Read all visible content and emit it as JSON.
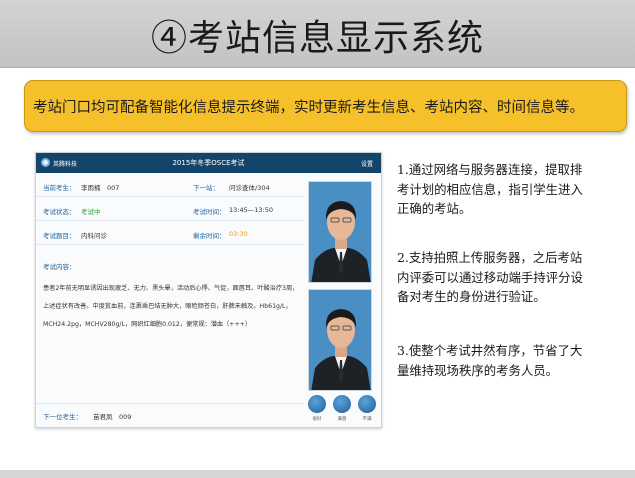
{
  "slide": {
    "title": "④考站信息显示系统",
    "banner": "考站门口均可配备智能化信息提示终端，实时更新考生信息、考站内容、时间信息等。"
  },
  "terminal": {
    "logo_text": "英腾科技",
    "title": "2015年冬季OSCE考试",
    "settings": "设置",
    "current_examinee_label": "当前考生：",
    "current_examinee_value": "李雨楠　007",
    "next_station_label": "下一站：",
    "next_station_value": "问诊查体/304",
    "exam_status_label": "考试状态：",
    "exam_status_value": "考试中",
    "exam_time_label": "考试时间：",
    "exam_time_value": "13:45—13:50",
    "exam_subject_label": "考试题目：",
    "exam_subject_value": "内科问诊",
    "remaining_label": "剩余时间：",
    "remaining_value": "03:30",
    "content_label": "考试内容：",
    "content_lines": [
      "患者2年前无明显诱因出现疲乏、无力、黑头晕，活动后心悸、气促，面唇耳、叶酸治疗3周，",
      "上述症状有改善。中度贫血前，连裹乘巴结无肿大，眼睑颜苍白，肝脾未触及。Hb61g/L，",
      "MCH24.2pg，MCHV280g/L，网织红细胞0.012，便常规：潜血（+++）"
    ],
    "next_examinee_label": "下一位考生：",
    "next_examinee_value": "苗君凤　009",
    "face_labels": [
      "很好",
      "满意",
      "不满"
    ]
  },
  "bullets": {
    "b1": [
      "1.通过网络与服务器连接，提取排",
      "考计划的相应信息，指引学生进入",
      "正确的考站。"
    ],
    "b2": [
      "2.支持拍照上传服务器，之后考站",
      "内评委可以通过移动端手持评分设",
      "备对考生的身份进行验证。"
    ],
    "b3": [
      "3.使整个考试井然有序，节省了大",
      "量维持现场秩序的考务人员。"
    ]
  },
  "colors": {
    "header_blue": "#13456b",
    "banner_yellow": "#f5c02a",
    "label_blue": "#1f5f9a",
    "status_green": "#23a23a",
    "timer_orange": "#ea9a18"
  }
}
